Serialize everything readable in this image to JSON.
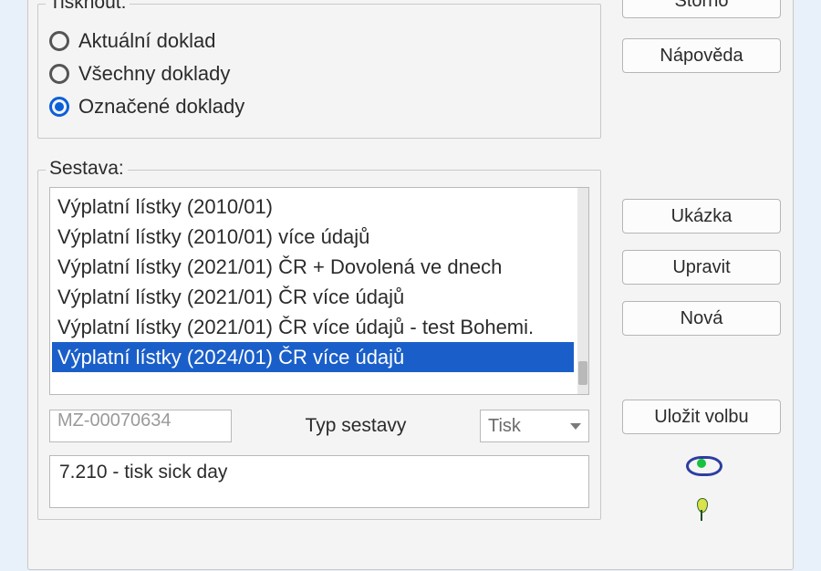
{
  "print_group": {
    "legend": "Tisknout:",
    "options": [
      {
        "label": "Aktuální doklad",
        "checked": false
      },
      {
        "label": "Všechny doklady",
        "checked": false
      },
      {
        "label": "Označené doklady",
        "checked": true
      }
    ]
  },
  "report_group": {
    "legend": "Sestava:",
    "items": [
      {
        "label": "Výplatní lístky (2010/01)",
        "selected": false
      },
      {
        "label": "Výplatní lístky (2010/01) více údajů",
        "selected": false
      },
      {
        "label": "Výplatní lístky (2021/01) ČR + Dovolená ve dnech",
        "selected": false
      },
      {
        "label": "Výplatní lístky (2021/01) ČR více údajů",
        "selected": false
      },
      {
        "label": "Výplatní lístky (2021/01) ČR více údajů - test Bohemi.",
        "selected": false
      },
      {
        "label": "Výplatní lístky (2024/01) ČR více údajů",
        "selected": true
      }
    ],
    "code_field": "MZ-00070634",
    "type_label": "Typ sestavy",
    "type_select": {
      "value": "Tisk"
    },
    "description": "7.210 - tisk sick day"
  },
  "side_buttons": {
    "storno": "Storno",
    "napoveda": "Nápověda",
    "ukazka": "Ukázka",
    "upravit": "Upravit",
    "nova": "Nová",
    "ulozit": "Uložit volbu"
  }
}
